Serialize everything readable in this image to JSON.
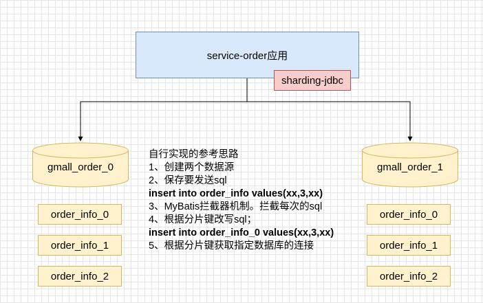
{
  "service": {
    "label": "service-order应用"
  },
  "middleware": {
    "label": "sharding-jdbc"
  },
  "databases": [
    {
      "label": "gmall_order_0",
      "tables": [
        "order_info_0",
        "order_info_1",
        "order_info_2"
      ]
    },
    {
      "label": "gmall_order_1",
      "tables": [
        "order_info_0",
        "order_info_1",
        "order_info_2"
      ]
    }
  ],
  "notes": [
    {
      "text": "自行实现的参考思路",
      "bold": false
    },
    {
      "text": "1、创建两个数据源",
      "bold": false
    },
    {
      "text": "2、保存要发送sql",
      "bold": false
    },
    {
      "text": "insert into order_info values(xx,3,xx)",
      "bold": true
    },
    {
      "text": "3、MyBatis拦截器机制。拦截每次的sql",
      "bold": false
    },
    {
      "text": "4、根据分片键改写sql；",
      "bold": false
    },
    {
      "text": "insert into order_info_0 values(xx,3,xx)",
      "bold": true
    },
    {
      "text": "5、根据分片键获取指定数据库的连接",
      "bold": false
    }
  ],
  "colors": {
    "service_fill": "#dae8fc",
    "service_stroke": "#6c8ebf",
    "middleware_fill": "#f8cecc",
    "middleware_stroke": "#b85450",
    "db_fill": "#fff2cc",
    "db_stroke": "#d6b656"
  }
}
